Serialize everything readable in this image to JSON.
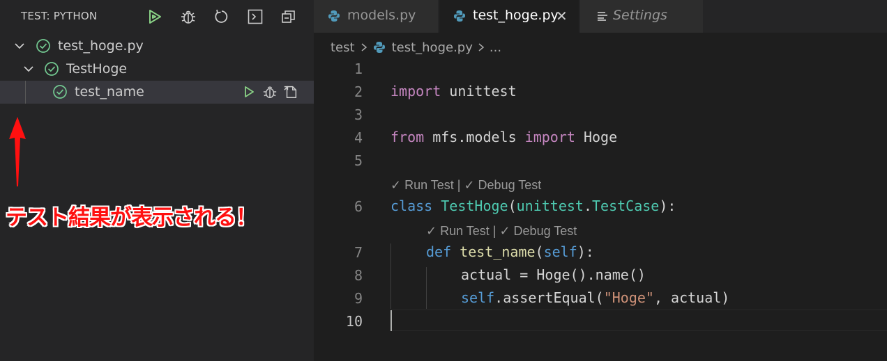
{
  "sidebar": {
    "title": "TEST: PYTHON",
    "actions": [
      "run-all-icon",
      "debug-icon",
      "refresh-icon",
      "terminal-icon",
      "collapse-all-icon"
    ],
    "tree": [
      {
        "label": "test_hoge.py",
        "status": "passed"
      },
      {
        "label": "TestHoge",
        "status": "passed"
      },
      {
        "label": "test_name",
        "status": "passed"
      }
    ]
  },
  "annotation": {
    "text": "テスト結果が表示される！",
    "color": "#ff1010"
  },
  "tabs": [
    {
      "label": "models.py",
      "active": false
    },
    {
      "label": "test_hoge.py",
      "active": true,
      "close": "✕"
    },
    {
      "label": "Settings",
      "active": false
    }
  ],
  "breadcrumb": {
    "folder": "test",
    "file": "test_hoge.py",
    "more": "..."
  },
  "code": {
    "line_numbers": [
      "1",
      "2",
      "3",
      "4",
      "5",
      "6",
      "7",
      "8",
      "9",
      "10"
    ],
    "lines": {
      "l2": {
        "kw": "import",
        "rest": " unittest"
      },
      "l4": {
        "kw1": "from",
        "mod": " mfs.models ",
        "kw2": "import",
        "cls": " Hoge"
      },
      "l6": {
        "kw": "class",
        "cls": " TestHoge",
        "p1": "(",
        "base": "unittest",
        "dot": ".",
        "basecls": "TestCase",
        "p2": "):"
      },
      "l7": {
        "kw": "def",
        "fn": " test_name",
        "p1": "(",
        "self": "self",
        "p2": "):"
      },
      "l8": {
        "text": "actual = Hoge().name()"
      },
      "l9": {
        "self": "self",
        "call": ".assertEqual(",
        "str": "\"Hoge\"",
        "rest": ", actual)"
      }
    },
    "codelens": {
      "class_lens": "✓ Run Test | ✓ Debug Test",
      "method_lens": "✓ Run Test | ✓ Debug Test"
    }
  },
  "colors": {
    "pass_green": "#73c991",
    "run_green": "#89d185",
    "python_blue": "#519aba"
  }
}
